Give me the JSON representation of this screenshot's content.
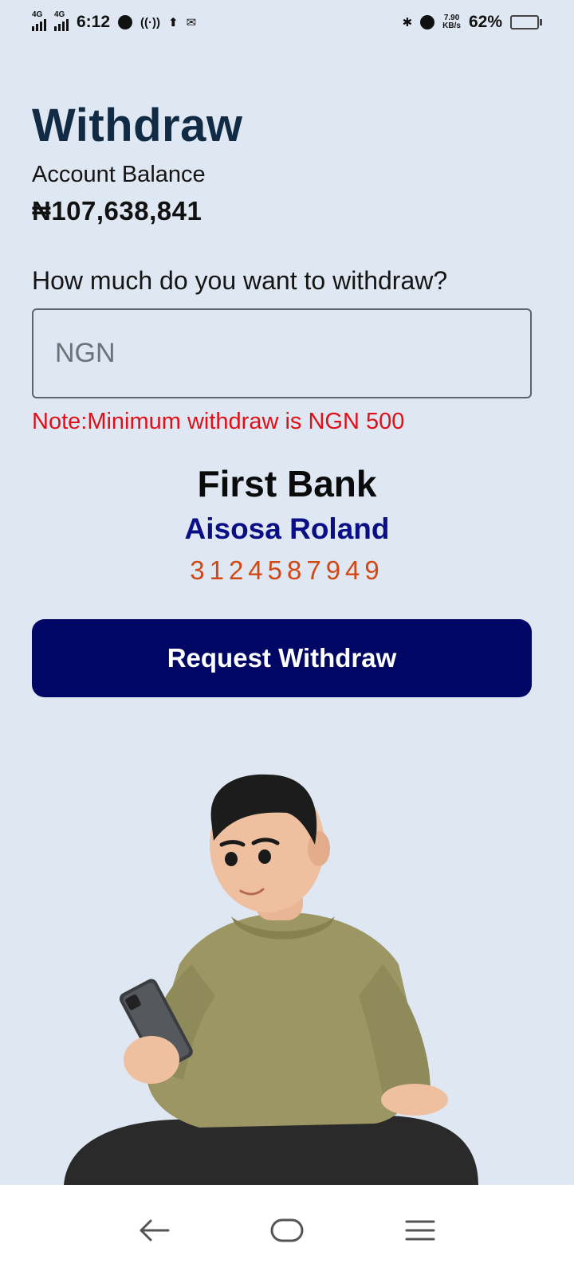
{
  "status_bar": {
    "network_1": "4G",
    "network_2": "4G",
    "time": "6:12",
    "speed_value": "7.90",
    "speed_unit": "KB/s",
    "battery_percent": "62%",
    "battery_level": 0.62,
    "icons": [
      "music-icon",
      "hotspot-icon",
      "upload-icon",
      "mail-icon",
      "bluetooth-icon",
      "alarm-icon"
    ]
  },
  "page": {
    "title": "Withdraw",
    "balance_label": "Account Balance",
    "balance_value": "₦107,638,841",
    "question": "How much do you want to withdraw?",
    "amount_placeholder": "NGN",
    "amount_value": "",
    "note": "Note:Minimum withdraw is NGN 500"
  },
  "bank": {
    "name": "First Bank",
    "account_name": "Aisosa Roland",
    "account_number": "3124587949"
  },
  "actions": {
    "request_label": "Request Withdraw"
  },
  "colors": {
    "background": "#dfe8f2",
    "title": "#112b44",
    "note": "#e0101a",
    "account_name": "#0a0f85",
    "account_number": "#d24713",
    "button": "#000664"
  },
  "nav": {
    "icons": [
      "back-icon",
      "home-icon",
      "menu-icon"
    ]
  }
}
